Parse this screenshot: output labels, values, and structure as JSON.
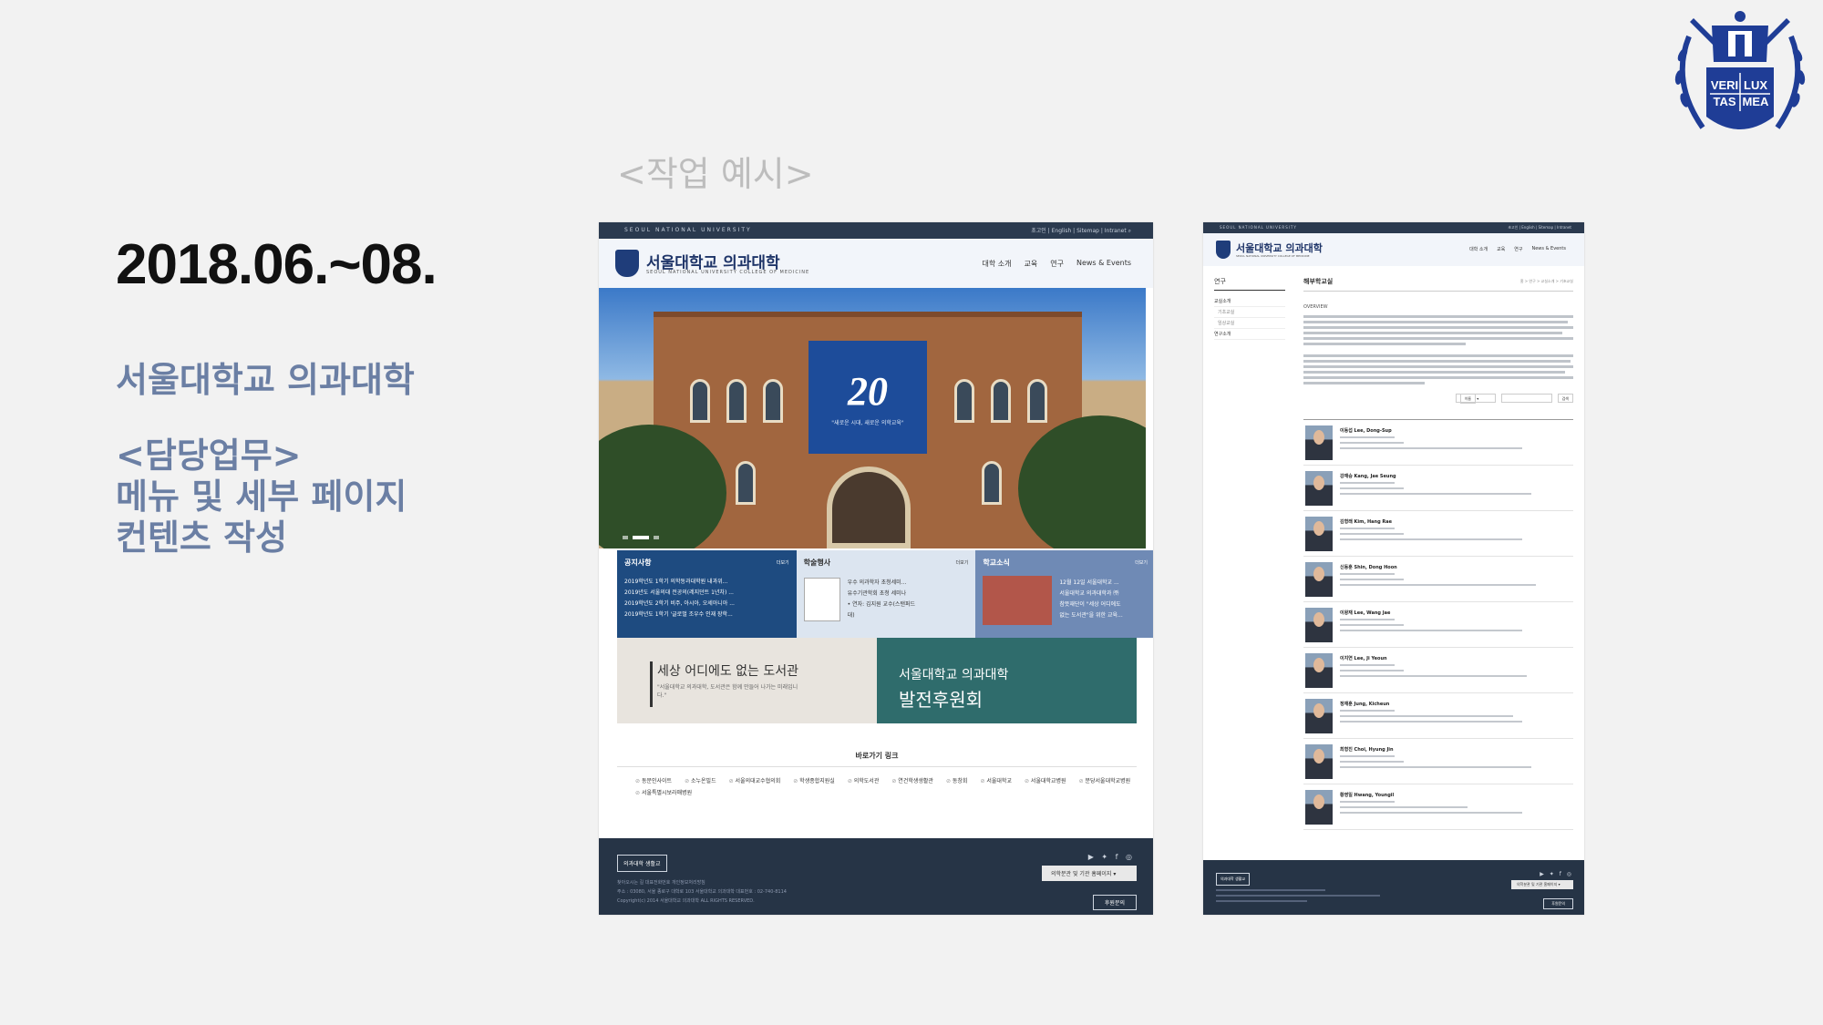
{
  "slide": {
    "date": "2018.06.~08.",
    "org": "서울대학교 의과대학",
    "role_title": "<담당업무>",
    "role_line1": "메뉴 및 세부 페이지",
    "role_line2": "컨텐츠 작성",
    "example_label": "<작업 예시>"
  },
  "logo": {
    "text1": "VERI",
    "text2": "LUX",
    "text3": "TAS",
    "text4": "MEA",
    "color": "#1f3d96"
  },
  "mockup_home": {
    "topbar_left": "SEOUL NATIONAL UNIVERSITY",
    "topbar_right": "초고인 | English | Sitemap | Intranet",
    "site_name": "서울대학교 의과대학",
    "site_sub": "SEOUL NATIONAL UNIVERSITY COLLEGE OF MEDICINE",
    "nav": [
      "대학 소개",
      "교육",
      "연구",
      "News & Events"
    ],
    "banner_number": "20",
    "banner_text": "\"새로운 시대, 새로운 의학교육\"",
    "cards": [
      {
        "title": "공지사항",
        "more": "더보기",
        "lines": [
          "2019학년도 1학기 의학동과대학원 내과위...",
          "2019년도 서울의대 전공의(레지던트 1년차) ...",
          "2019학년도 2학기 비주, 아시아, 오세아니아 ...",
          "2019학년도 1학기 '글로벌 조우수 인재 장학..."
        ]
      },
      {
        "title": "학술행사",
        "more": "더보기",
        "lines": [
          "우수 의과학자 초청세미...",
          "유수기관학회 초청 세미나",
          "• 연자: 김지원 교수(스탠퍼드",
          "대)"
        ]
      },
      {
        "title": "학교소식",
        "more": "더보기",
        "lines": [
          "12월 12일 서울대학교 ...",
          "서울대학교 의과대학과 ㈜",
          "참뜻재단이 \"세상 어디에도",
          "없는 도서관\"을 위한 교육..."
        ]
      }
    ],
    "promo_library_title": "세상 어디에도 없는 도서관",
    "promo_library_sub": "\"서울대학교 의과대학, 도서관은 함께 만들어 나가는 미래입니다.\"",
    "promo_dev_line1": "서울대학교 의과대학",
    "promo_dev_line2": "발전후원회",
    "links_title": "바로가기 링크",
    "links": [
      "동문인사이트",
      "소누온빌드",
      "서울의대교수협의회",
      "학생종합지원실",
      "의학도서관",
      "연건학생생활관",
      "동창회",
      "서울대학교",
      "서울대학교병원",
      "분당서울대학교병원",
      "서울특별시보라매병원"
    ],
    "footer_button": "의과대학 생활교",
    "footer_links": "찾아오시는 길    대표전화번호    개인정보처리방침",
    "footer_address": "주소 : 03080, 서울 종로구 대학로 103 서울대학교 의과대학  대표번호 : 02-740-8114",
    "footer_copyright": "Copyright(c) 2014 서울대학교 의과대학 ALL RIGHTS RESERVED.",
    "footer_select": "의학분관 및 기관 홈페이지",
    "footer_button2": "후원문의"
  },
  "mockup_detail": {
    "topbar_left": "SEOUL NATIONAL UNIVERSITY",
    "topbar_right": "초고인 | English | Sitemap | Intranet",
    "site_name": "서울대학교 의과대학",
    "site_sub": "SEOUL NATIONAL UNIVERSITY COLLEGE OF MEDICINE",
    "nav": [
      "대학 소개",
      "교육",
      "연구",
      "News & Events"
    ],
    "side_title": "연구",
    "side_items": [
      "교실소개",
      "기초교실",
      "임상교실",
      "연구소개"
    ],
    "page_title": "해부학교실",
    "breadcrumb": "홈 > 연구 > 교실소개 > 기초교실",
    "overview": "OVERVIEW",
    "search_select": "이름",
    "search_button": "검색",
    "people": [
      "이동섭 Lee, Dong-Sup",
      "강재승 Kang, Jae Seung",
      "김형래 Kim, Hang Rae",
      "신동훈 Shin, Dong Hoon",
      "이왕재 Lee, Wang Jae",
      "이지연 Lee, Ji Yeoun",
      "정재훈 Jung, Kicheun",
      "최형진 Choi, Hyung Jin",
      "황영일 Hwang, Youngil"
    ],
    "footer_button": "의과대학 생활교",
    "footer_select": "의학분관 및 기관 홈페이지",
    "footer_button2": "후원문의"
  }
}
